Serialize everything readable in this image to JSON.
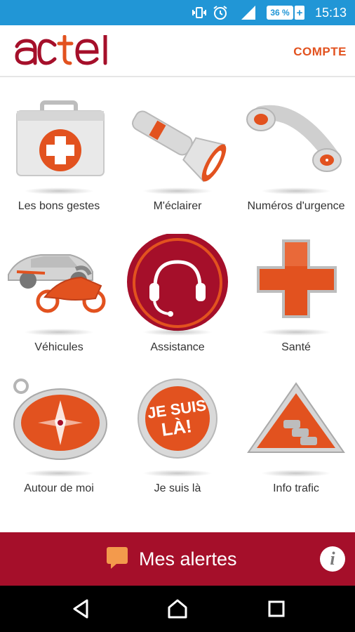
{
  "status_bar": {
    "time": "15:13",
    "battery": "36 %",
    "battery_plus": "+",
    "icons": [
      "vibrate-icon",
      "alarm-icon",
      "signal-icon",
      "battery-icon"
    ]
  },
  "header": {
    "logo_text": "actel",
    "account_label": "COMPTE"
  },
  "grid": {
    "items": [
      {
        "label": "Les bons gestes",
        "icon": "first-aid-kit-icon"
      },
      {
        "label": "M'éclairer",
        "icon": "flashlight-icon"
      },
      {
        "label": "Numéros d'urgence",
        "icon": "phone-handset-icon"
      },
      {
        "label": "Véhicules",
        "icon": "car-motorcycle-icon"
      },
      {
        "label": "Assistance",
        "icon": "headset-icon"
      },
      {
        "label": "Santé",
        "icon": "medical-cross-icon"
      },
      {
        "label": "Autour de moi",
        "icon": "compass-icon"
      },
      {
        "label": "Je suis là",
        "icon": "je-suis-la-badge-icon",
        "badge_text": "JE SUIS LÀ!"
      },
      {
        "label": "Info trafic",
        "icon": "traffic-warning-icon"
      }
    ]
  },
  "alerts_bar": {
    "label": "Mes alertes",
    "info_symbol": "i"
  },
  "nav_bar": {
    "icons": [
      "back-icon",
      "home-icon",
      "recents-icon"
    ]
  },
  "colors": {
    "status_bar": "#2196d6",
    "brand_red": "#a50f2a",
    "accent_orange": "#e2521f"
  }
}
